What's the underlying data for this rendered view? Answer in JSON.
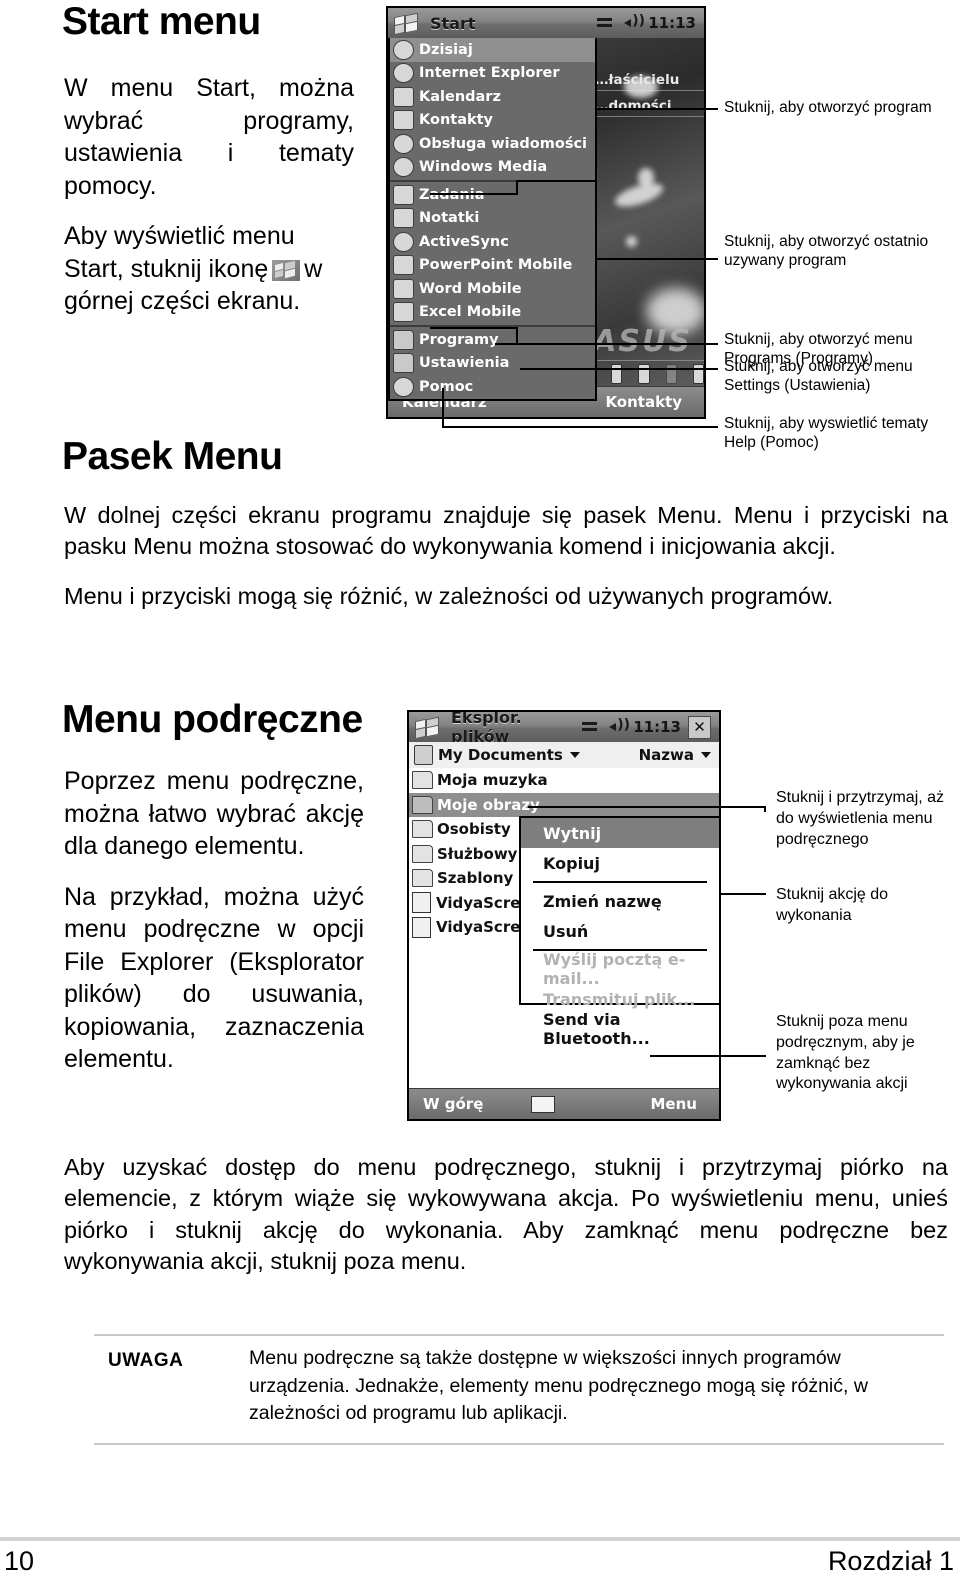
{
  "sections": {
    "start_menu": {
      "heading": "Start menu",
      "para1": "W menu Start, można wybrać programy, ustawienia i tematy pomocy.",
      "para2_a": "Aby wyświetlić menu Start, stuknij ikonę",
      "para2_b": "w górnej części ekranu."
    },
    "pasek_menu": {
      "heading": "Pasek Menu",
      "para1": "W dolnej części ekranu programu znajduje się pasek Menu. Menu i przyciski na pasku Menu można stosować do wykonywania komend i inicjowania akcji.",
      "para2": "Menu i przyciski mogą się różnić, w zależności od używanych programów."
    },
    "menu_podreczne": {
      "heading": "Menu podręczne",
      "para1": "Poprzez menu podręczne, można łatwo wybrać akcję dla danego elementu.",
      "para2": "Na przykład, można użyć menu podręczne w opcji File Explorer (Eksplorator plików) do usuwania, kopiowania, zaznaczenia elementu.",
      "para3": "Aby uzyskać dostęp do menu podręcznego, stuknij i przytrzymaj piórko na elemencie, z którym wiąże się wykowywana akcja. Po wyświetleniu menu, unieś piórko i stuknij akcję do wykonania. Aby zamknąć menu podręczne bez wykonywania akcji, stuknij poza menu."
    }
  },
  "callouts_start": [
    {
      "id": "open-program",
      "text": "Stuknij, aby otworzyć program"
    },
    {
      "id": "recent-program",
      "text": "Stuknij, aby otworzyć ostatnio uzywany program"
    },
    {
      "id": "programs-menu",
      "text": "Stuknij, aby otworzyć menu Programs (Programy)"
    },
    {
      "id": "settings-menu",
      "text": "Stuknij, aby otworzyć menu Settings (Ustawienia)"
    },
    {
      "id": "help-topics",
      "text": "Stuknij, aby wyswietlić tematy Help (Pomoc)"
    }
  ],
  "callouts_popup": [
    {
      "id": "tap-and-hold",
      "text": "Stuknij i przytrzymaj, aż do wyświetlenia menu podręcznego"
    },
    {
      "id": "tap-action",
      "text": "Stuknij akcję do wykonania"
    },
    {
      "id": "tap-outside",
      "text": "Stuknij poza menu podręcznym, aby je zamknąć bez wykonywania akcji"
    }
  ],
  "screenshot_start": {
    "titlebar": {
      "title": "Start",
      "time": "11:13"
    },
    "menu_group1": [
      {
        "label": "Dzisiaj",
        "icon": "today-icon",
        "selected": true
      },
      {
        "label": "Internet Explorer",
        "icon": "ie-icon",
        "selected": false
      },
      {
        "label": "Kalendarz",
        "icon": "calendar-icon",
        "selected": false
      },
      {
        "label": "Kontakty",
        "icon": "contacts-icon",
        "selected": false
      },
      {
        "label": "Obsługa wiadomości",
        "icon": "messaging-icon",
        "selected": false
      },
      {
        "label": "Windows Media",
        "icon": "media-icon",
        "selected": false
      }
    ],
    "menu_group2": [
      {
        "label": "Zadania",
        "icon": "tasks-icon"
      },
      {
        "label": "Notatki",
        "icon": "notes-icon"
      },
      {
        "label": "ActiveSync",
        "icon": "activesync-icon"
      },
      {
        "label": "PowerPoint Mobile",
        "icon": "powerpoint-icon"
      },
      {
        "label": "Word Mobile",
        "icon": "word-icon"
      },
      {
        "label": "Excel Mobile",
        "icon": "excel-icon"
      }
    ],
    "menu_group3": [
      {
        "label": "Programy",
        "icon": "programs-folder-icon"
      },
      {
        "label": "Ustawienia",
        "icon": "settings-folder-icon"
      },
      {
        "label": "Pomoc",
        "icon": "help-icon"
      }
    ],
    "today_rows": [
      "…łaścicielu",
      "…domości"
    ],
    "brand": "ASUS",
    "softkeys": {
      "left": "Kalendarz",
      "right": "Kontakty"
    }
  },
  "screenshot_explorer": {
    "titlebar": {
      "title": "Eksplor. plików",
      "time": "11:13",
      "close": "✕"
    },
    "command_bar": {
      "folder": "My Documents",
      "sort": "Nazwa"
    },
    "items": [
      {
        "label": "Moja muzyka",
        "type": "folder",
        "selected": false
      },
      {
        "label": "Moje obrazy",
        "type": "folder",
        "selected": true
      },
      {
        "label": "Osobisty",
        "type": "folder",
        "selected": false
      },
      {
        "label": "Służbowy",
        "type": "folder",
        "selected": false
      },
      {
        "label": "Szablony",
        "type": "folder",
        "selected": false
      },
      {
        "label": "VidyaScree",
        "type": "file",
        "selected": false
      },
      {
        "label": "VidyaScree",
        "type": "file",
        "selected": false
      }
    ],
    "context_menu": [
      {
        "label": "Wytnij",
        "state": "selected"
      },
      {
        "label": "Kopiuj",
        "state": "normal"
      },
      {
        "label": "__sep__",
        "state": "separator"
      },
      {
        "label": "Zmień nazwę",
        "state": "normal"
      },
      {
        "label": "Usuń",
        "state": "normal"
      },
      {
        "label": "__sep__",
        "state": "separator"
      },
      {
        "label": "Wyślij pocztą e-mail...",
        "state": "disabled"
      },
      {
        "label": "Transmituj plik...",
        "state": "disabled"
      },
      {
        "label": "Send via Bluetooth...",
        "state": "normal"
      }
    ],
    "softkeys": {
      "left": "W górę",
      "center": "keyboard-icon",
      "right": "Menu"
    }
  },
  "note": {
    "label": "UWAGA",
    "text": "Menu podręczne są także dostępne w większości innych programów urządzenia. Jednakże, elementy menu podręcznego mogą się różnić, w zależności od programu lub aplikacji."
  },
  "footer": {
    "page": "10",
    "chapter": "Rozdział 1"
  }
}
